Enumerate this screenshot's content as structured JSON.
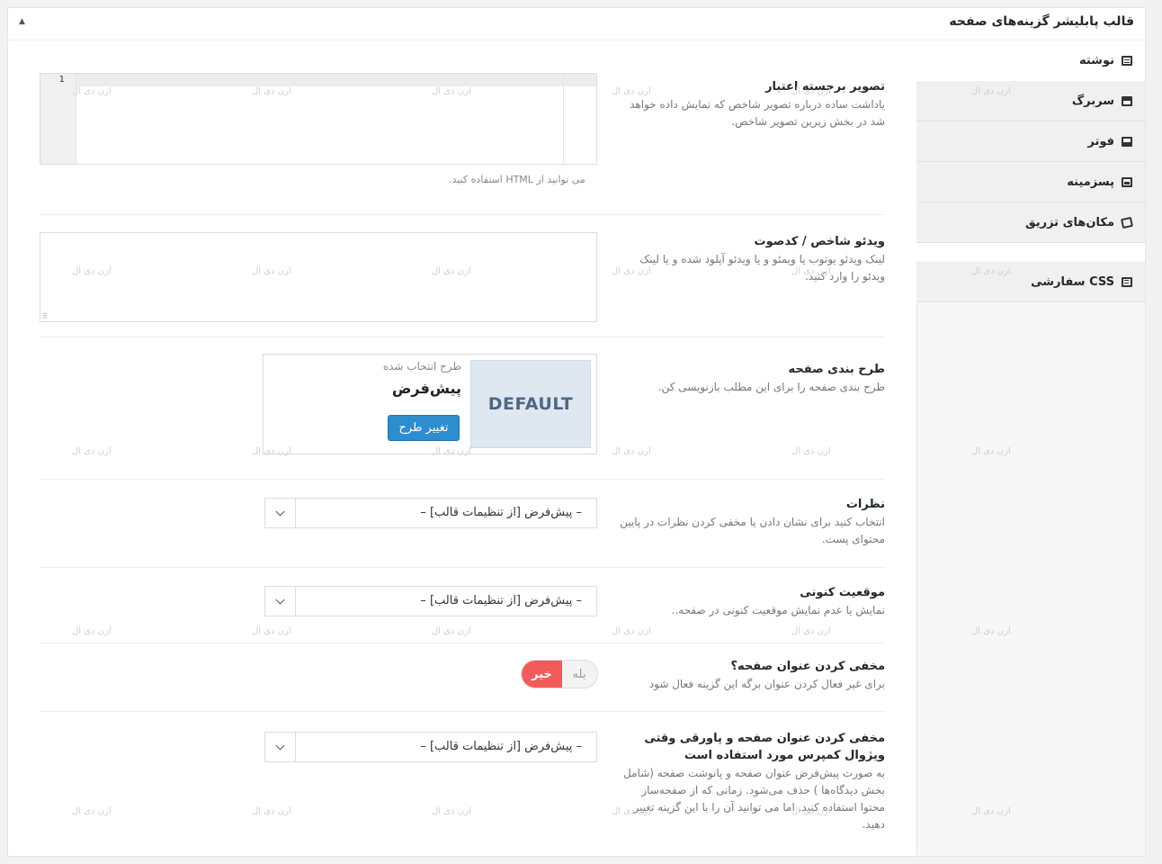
{
  "panel": {
    "title": "قالب پابلیشر گزینه‌های صفحه",
    "collapse_symbol": "▲"
  },
  "tabs": [
    {
      "label": "نوشته",
      "icon": "post-icon",
      "active": true
    },
    {
      "label": "سربرگ",
      "icon": "header-icon",
      "active": false
    },
    {
      "label": "فوتر",
      "icon": "footer-icon",
      "active": false
    },
    {
      "label": "پسزمینه",
      "icon": "background-icon",
      "active": false
    },
    {
      "label": "مکان‌های تزریق",
      "icon": "inject-icon",
      "active": false
    },
    {
      "label": "CSS سفارشی",
      "icon": "css-icon",
      "active": false
    }
  ],
  "fields": {
    "featured_image_credit": {
      "title": "تصویر برجسته اعتبار",
      "description": "یاداشت ساده درباره تصویر شاخص که نمایش داده خواهد شد در بخش زیرین تصویر شاخص.",
      "line_number": "1",
      "hint": "می توانید از HTML استفاده کنید."
    },
    "featured_video": {
      "title": "ویدئو شاخص / کدصوت",
      "description": "لینک ویدئو یوتوب یا ویمئو و یا ویدئو آپلود شده و یا لینک ویدئو را وارد کنید.",
      "resize_symbol": "⠿"
    },
    "page_layout": {
      "title": "طرح بندی صفحه",
      "description": "طرح بندی صفحه را برای این مطلب بازنویسی کن.",
      "selected_caption": "طرح انتخاب شده",
      "selected_name": "پیش‌فرض",
      "thumb_label": "DEFAULT",
      "change_button": "تغییر طرح"
    },
    "comments": {
      "title": "نظرات",
      "description": "انتخاب کنید برای نشان دادن یا مخفی کردن نظرات در پایین محتوای پست.",
      "value": "– پیش‌فرض [از تنظیمات قالب] –"
    },
    "breadcrumb": {
      "title": "موقعیت کنونی",
      "description": "نمایش یا عدم نمایش موقعیت کنونی در صفحه..",
      "value": "– پیش‌فرض [از تنظیمات قالب] –"
    },
    "hide_title": {
      "title": "مخفی کردن عنوان صفحه؟",
      "description": "برای غیر فعال کردن عنوان برگه این گزینه فعال شود",
      "toggle_yes": "بله",
      "toggle_no": "خیر",
      "selected": "no"
    },
    "hide_title_vc": {
      "title": "مخفی کردن عنوان صفحه و پاورقی وقتی ویژوال کمپرس مورد استفاده است",
      "description": "به صورت پیش‌فرض عنوان صفحه و پانوشت صفحه (شامل بخش دیدگاه‌ها ) حذف می‌شود. زمانی که از صفحه‌ساز محتوا استفاده کنید. اما می توانید آن را با این گزینه تغییر دهید.",
      "value": "– پیش‌فرض [از تنظیمات قالب] –"
    }
  },
  "watermark": "ارن دی ال",
  "colors": {
    "button_blue": "#2e8dcf",
    "toggle_red": "#f25b5b",
    "layout_thumb_bg": "#dfe7f1"
  }
}
